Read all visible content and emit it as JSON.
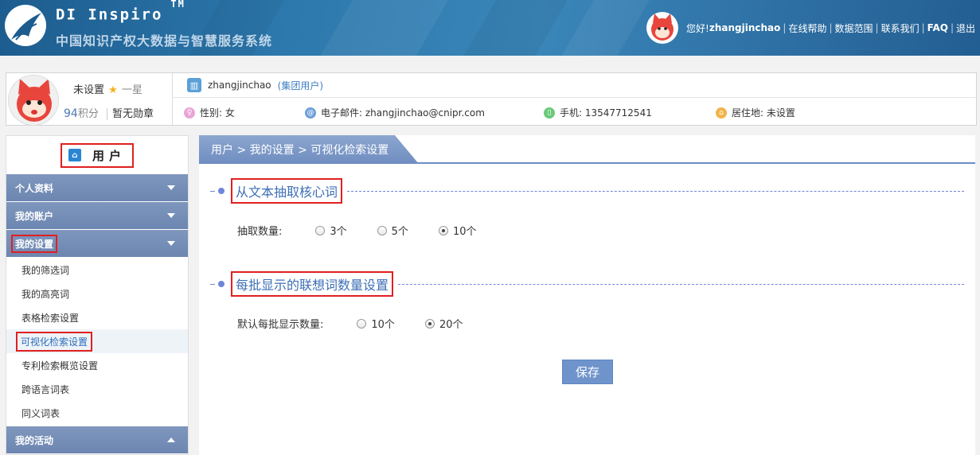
{
  "header": {
    "brand": "DI Inspiro",
    "trademark": "TM",
    "tagline": "中国知识产权大数据与智慧服务系统",
    "greeting": "您好!",
    "username": "zhangjinchao",
    "links": [
      "在线帮助",
      "数据范围",
      "联系我们",
      "FAQ",
      "退出"
    ],
    "separator": "|"
  },
  "profile": {
    "level_text": "未设置",
    "level_star": "一星",
    "score": "94",
    "score_unit": "积分",
    "badge": "暂无勋章",
    "username": "zhangjinchao",
    "group": "(集团用户)",
    "gender": "性别: 女",
    "email": "电子邮件: zhangjinchao@cnipr.com",
    "phone": "手机: 13547712541",
    "residence": "居住地: 未设置"
  },
  "sidebar": {
    "title": "用户",
    "sections": {
      "profile": "个人资料",
      "account": "我的账户",
      "settings": "我的设置",
      "activity": "我的活动"
    },
    "items": [
      "我的筛选词",
      "我的高亮词",
      "表格检索设置",
      "可视化检索设置",
      "专利检索概览设置",
      "跨语言词表",
      "同义词表"
    ]
  },
  "main": {
    "breadcrumb": "用户 > 我的设置 > 可视化检索设置",
    "section1": {
      "title": "从文本抽取核心词",
      "label": "抽取数量:",
      "options": [
        "3个",
        "5个",
        "10个"
      ],
      "selected": "10个"
    },
    "section2": {
      "title": "每批显示的联想词数量设置",
      "label": "默认每批显示数量:",
      "options": [
        "10个",
        "20个"
      ],
      "selected": "20个"
    },
    "save_label": "保存"
  },
  "colors": {
    "header_bg": "#2d79ad",
    "sidebar_section_bg": "#7f97bd",
    "tab_bg": "#7f9bc8",
    "highlight_box": "#e02020",
    "save_button": "#6f94cc"
  }
}
